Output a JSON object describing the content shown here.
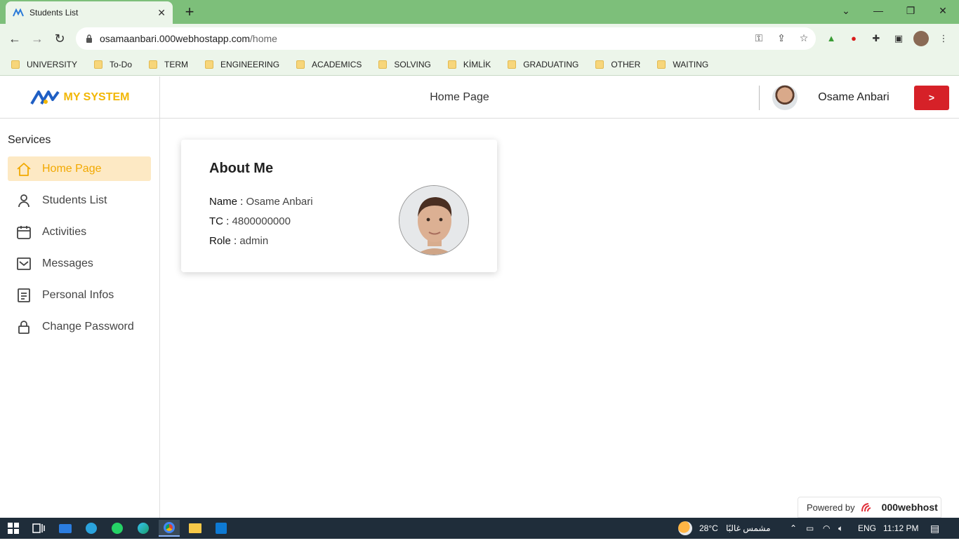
{
  "browser": {
    "tab_title": "Students List",
    "tab_close": "✕",
    "new_tab": "+",
    "url_host": "osamaanbari.000webhostapp.com",
    "url_path": "/home",
    "window_controls": [
      "⌄",
      "—",
      "❐",
      "✕"
    ],
    "bookmarks": [
      "UNIVERSITY",
      "To-Do",
      "TERM",
      "ENGINEERING",
      "ACADEMICS",
      "SOLVING",
      "KİMLİK",
      "GRADUATING",
      "OTHER",
      "WAITING"
    ]
  },
  "app": {
    "brand_text": "MY SYSTEM",
    "page_title": "Home Page",
    "user_name": "Osame Anbari",
    "logout_label": ">"
  },
  "sidebar": {
    "title": "Services",
    "items": [
      {
        "label": "Home Page",
        "icon": "home-icon"
      },
      {
        "label": "Students List",
        "icon": "user-icon"
      },
      {
        "label": "Activities",
        "icon": "calendar-icon"
      },
      {
        "label": "Messages",
        "icon": "mail-icon"
      },
      {
        "label": "Personal Infos",
        "icon": "document-icon"
      },
      {
        "label": "Change Password",
        "icon": "lock-icon"
      }
    ]
  },
  "about": {
    "title": "About Me",
    "name_label": "Name :",
    "name_value": "Osame Anbari",
    "tc_label": "TC :",
    "tc_value": "4800000000",
    "role_label": "Role :",
    "role_value": "admin"
  },
  "footer": {
    "powered_by": "Powered by",
    "host_brand": "000webhost"
  },
  "taskbar": {
    "weather": "28°C",
    "weather_desc": "مشمس غالبًا",
    "language": "ENG",
    "time": "11:12 PM"
  },
  "colors": {
    "accent": "#f2a900",
    "active_bg": "#fde9c4",
    "logout": "#d62128",
    "chrome_green": "#7dbf7a"
  }
}
